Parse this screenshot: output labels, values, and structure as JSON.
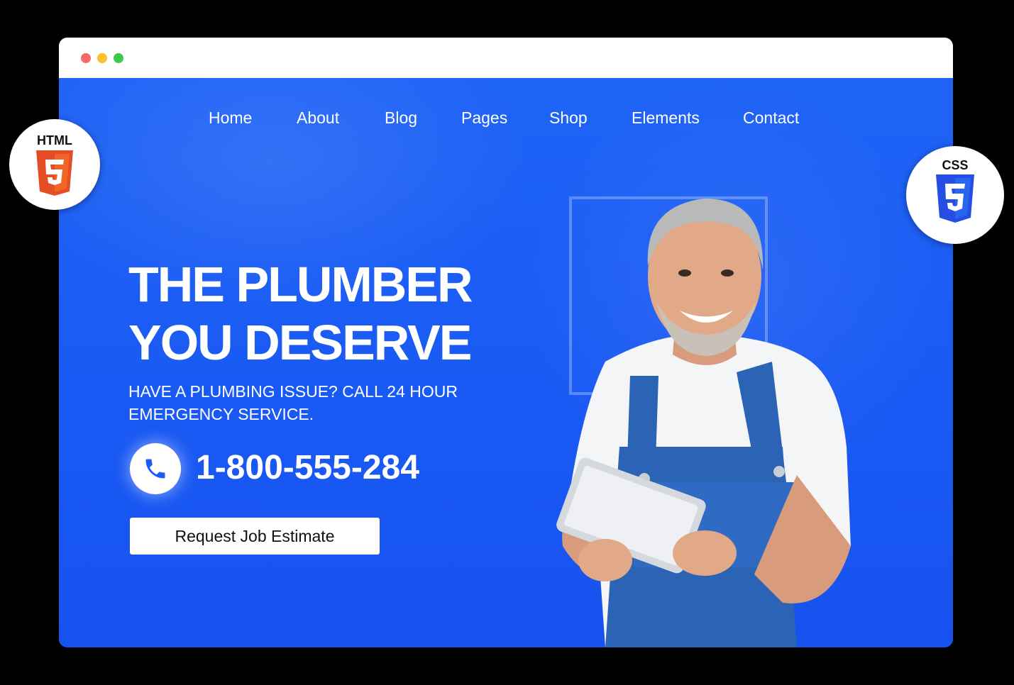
{
  "nav": {
    "items": [
      "Home",
      "About",
      "Blog",
      "Pages",
      "Shop",
      "Elements",
      "Contact"
    ]
  },
  "hero": {
    "headline_line1": "THE PLUMBER",
    "headline_line2": "YOU DESERVE",
    "subtext_line1": "HAVE A PLUMBING ISSUE? CALL 24 HOUR",
    "subtext_line2": "EMERGENCY SERVICE.",
    "phone_number": "1-800-555-284",
    "cta_label": "Request Job Estimate"
  },
  "badges": {
    "html_label": "HTML",
    "css_label": "CSS"
  },
  "icons": {
    "phone": "phone-icon",
    "html5": "html5-icon",
    "css3": "css3-icon"
  },
  "colors": {
    "hero_blue": "#1b5cf5",
    "html_orange": "#e44d26",
    "css_blue": "#264de4",
    "dot_red": "#f36a6a",
    "dot_yellow": "#f8c22c",
    "dot_green": "#3ec94b"
  }
}
